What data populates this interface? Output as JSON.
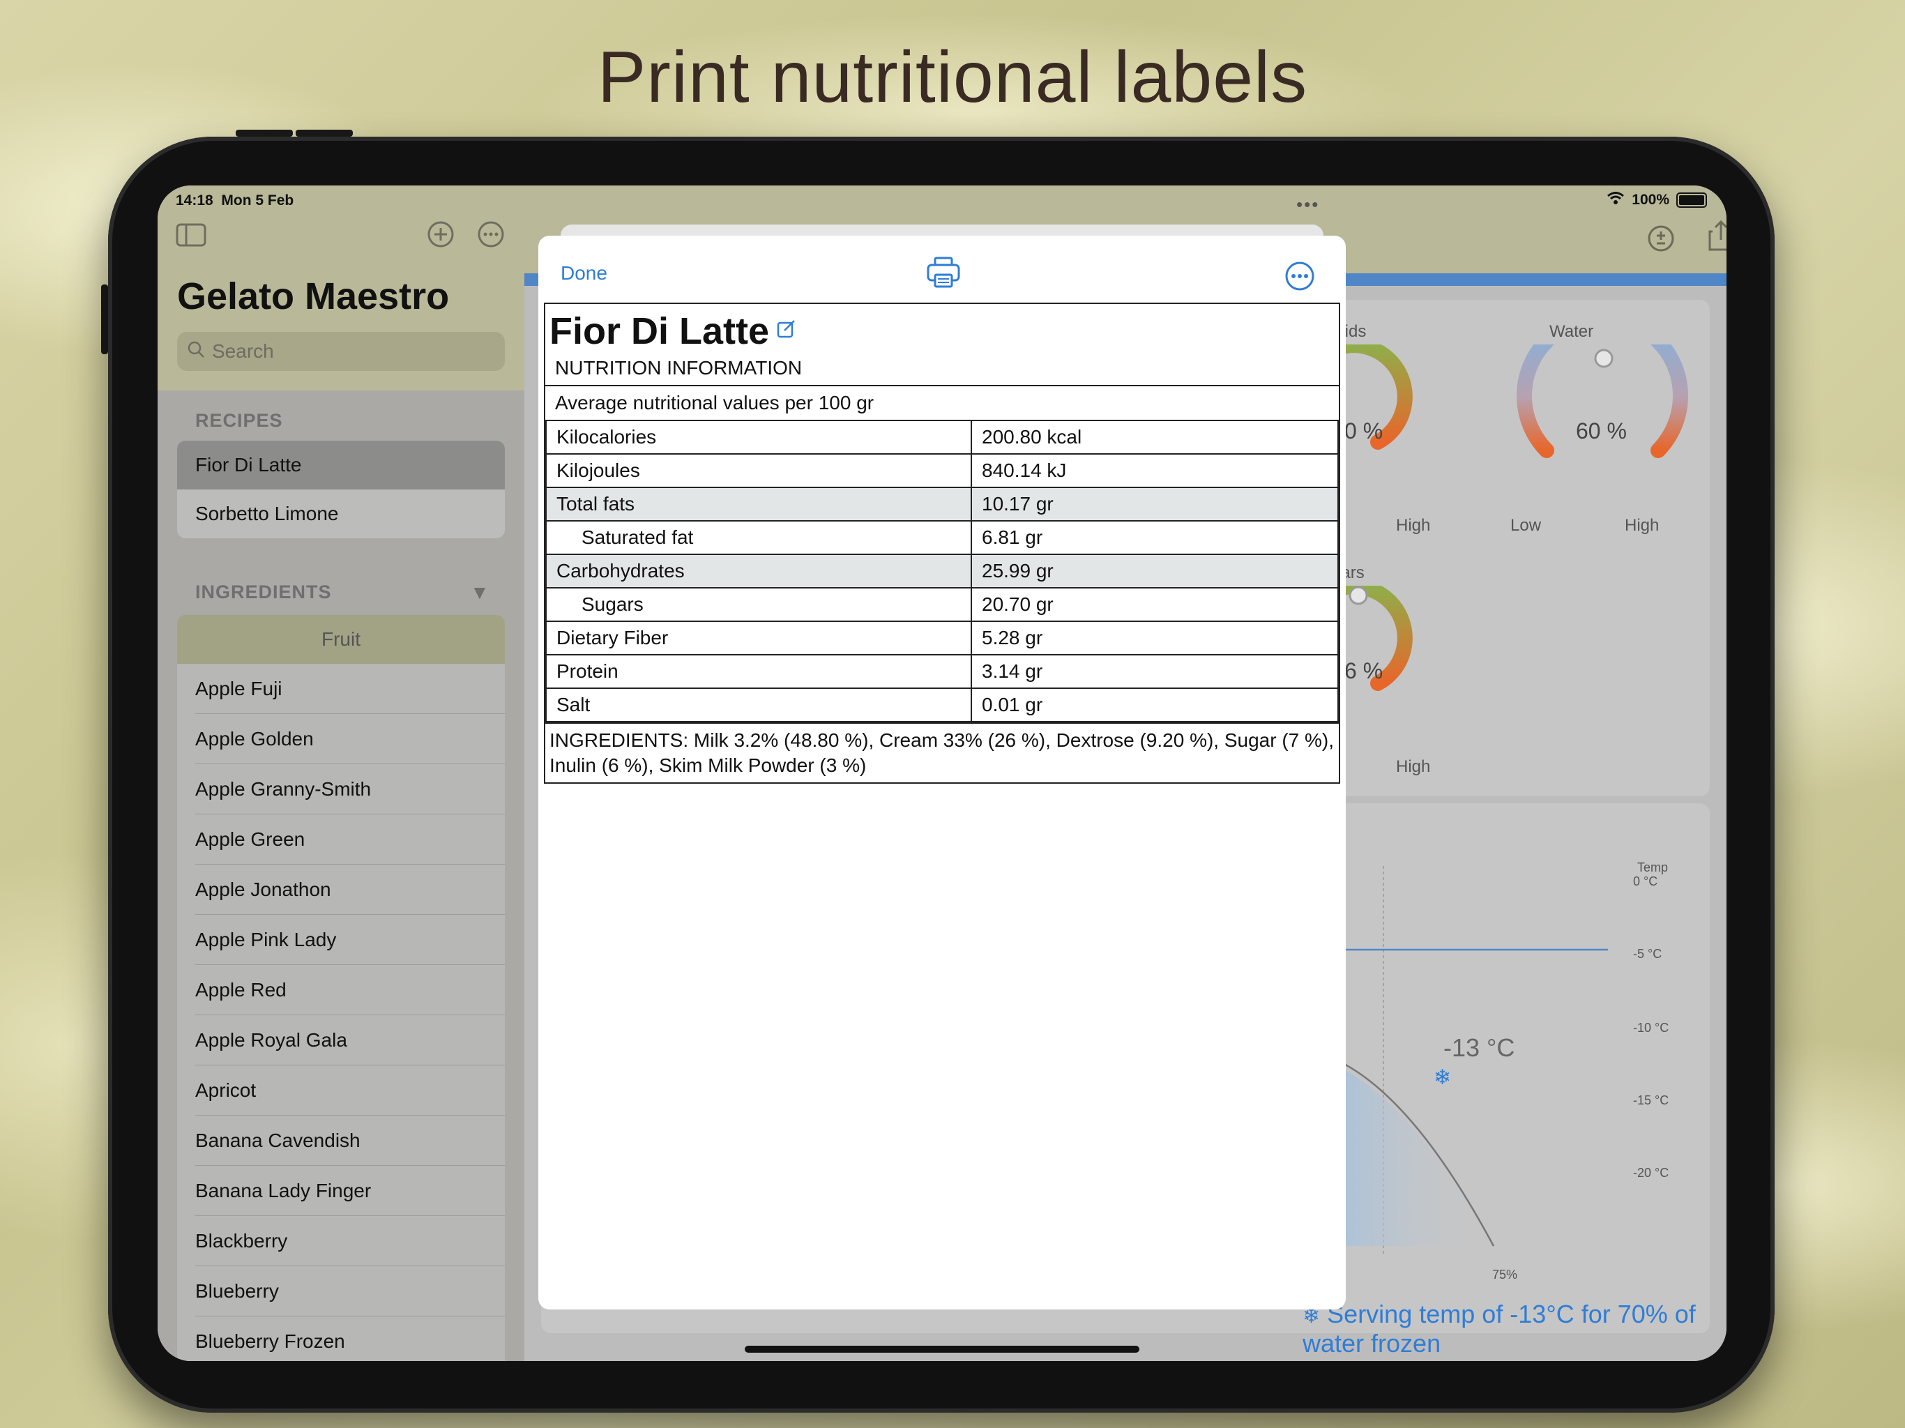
{
  "headline": "Print nutritional labels",
  "status": {
    "time": "14:18",
    "date": "Mon 5 Feb",
    "battery": "100%"
  },
  "sidebar": {
    "title": "Gelato Maestro",
    "search_placeholder": "Search",
    "recipes_header": "RECIPES",
    "recipes": [
      "Fior Di Latte",
      "Sorbetto Limone"
    ],
    "ingredients_header": "INGREDIENTS",
    "category_chip": "Fruit",
    "ingredients": [
      "Apple Fuji",
      "Apple Golden",
      "Apple Granny-Smith",
      "Apple Green",
      "Apple Jonathon",
      "Apple Pink Lady",
      "Apple Red",
      "Apple Royal Gala",
      "Apricot",
      "Banana Cavendish",
      "Banana Lady Finger",
      "Blackberry",
      "Blueberry",
      "Blueberry Frozen"
    ]
  },
  "background_panel": {
    "gauges": [
      {
        "title": "olids",
        "value": "0 %",
        "left_label": "",
        "right_label": "High"
      },
      {
        "title": "Water",
        "value": "60 %",
        "left_label": "Low",
        "right_label": "High"
      },
      {
        "title": "gars",
        "value": "6 %",
        "left_label": "",
        "right_label": "High"
      }
    ],
    "temp_chart": {
      "axis_title": "Temp",
      "ticks": [
        "0 °C",
        "-5 °C",
        "-10 °C",
        "-15 °C",
        "-20 °C"
      ],
      "x_tick": "75%",
      "marker_label": "-13 °C"
    },
    "serving_note": "Serving temp of -13°C for 70% of water frozen"
  },
  "label_sheet": {
    "done_label": "Done",
    "recipe_name": "Fior Di Latte",
    "subtitle": "NUTRITION INFORMATION",
    "per_note": "Average nutritional values per 100 gr",
    "rows": [
      {
        "name": "Kilocalories",
        "value": "200.80 kcal",
        "indent": false,
        "shade": false
      },
      {
        "name": "Kilojoules",
        "value": "840.14 kJ",
        "indent": false,
        "shade": false
      },
      {
        "name": "Total fats",
        "value": "10.17 gr",
        "indent": false,
        "shade": true
      },
      {
        "name": "Saturated fat",
        "value": "6.81 gr",
        "indent": true,
        "shade": false
      },
      {
        "name": "Carbohydrates",
        "value": "25.99 gr",
        "indent": false,
        "shade": true
      },
      {
        "name": "Sugars",
        "value": "20.70 gr",
        "indent": true,
        "shade": false
      },
      {
        "name": "Dietary Fiber",
        "value": "5.28 gr",
        "indent": false,
        "shade": false
      },
      {
        "name": "Protein",
        "value": "3.14 gr",
        "indent": false,
        "shade": false
      },
      {
        "name": "Salt",
        "value": "0.01 gr",
        "indent": false,
        "shade": false
      }
    ],
    "ingredients_text": "INGREDIENTS: Milk 3.2% (48.80 %), Cream 33% (26 %), Dextrose (9.20 %), Sugar (7 %), Inulin (6 %), Skim Milk Powder (3 %)"
  },
  "colors": {
    "accent": "#2f7dd6",
    "water_gauge": "#7fb3e0",
    "solids_gauge": "#8fae4a",
    "gauge_end": "#e8662a"
  }
}
